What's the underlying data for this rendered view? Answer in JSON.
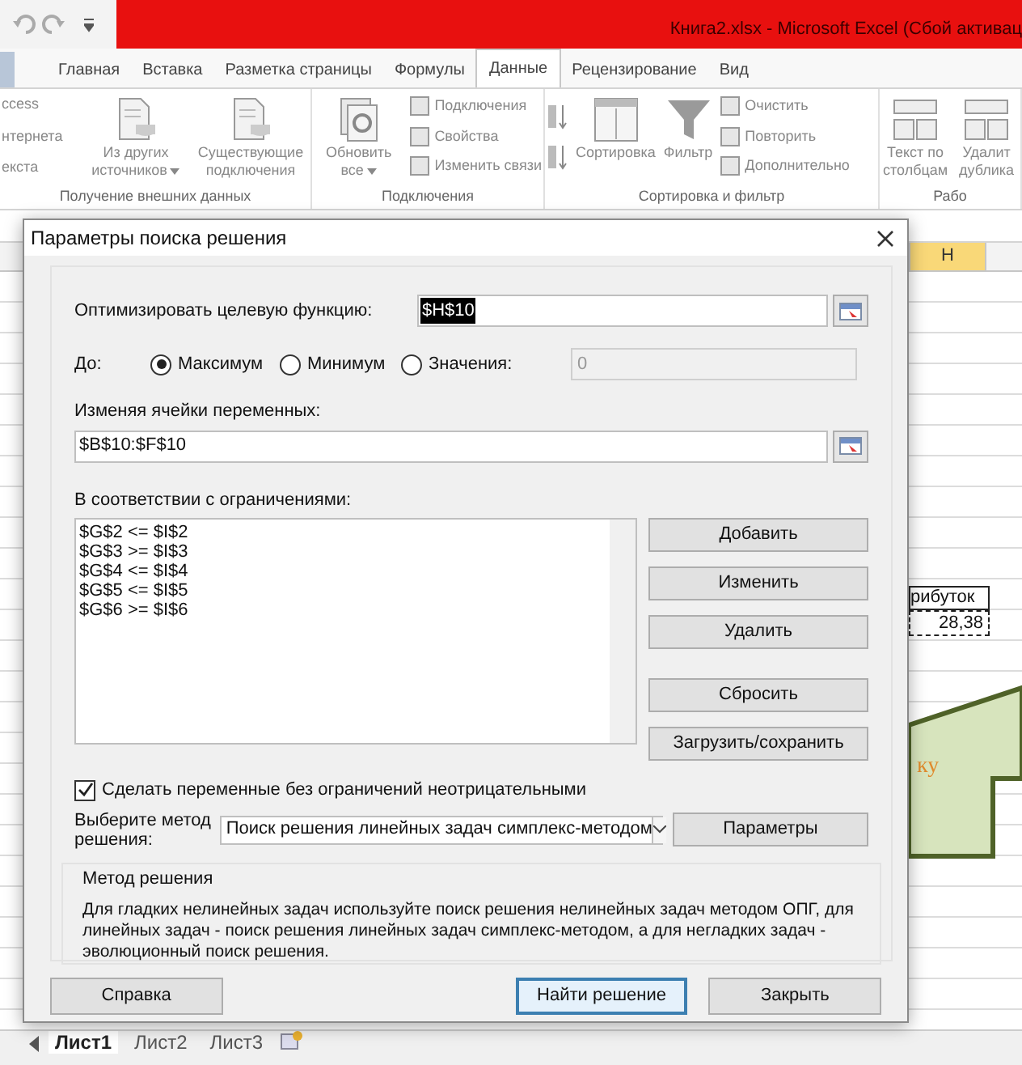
{
  "title_bar": {
    "title": "Книга2.xlsx  -  Microsoft Excel (Сбой активац"
  },
  "ribbon_tabs": [
    {
      "label": "Главная",
      "selected": false
    },
    {
      "label": "Вставка",
      "selected": false
    },
    {
      "label": "Разметка страницы",
      "selected": false
    },
    {
      "label": "Формулы",
      "selected": false
    },
    {
      "label": "Данные",
      "selected": true
    },
    {
      "label": "Рецензирование",
      "selected": false
    },
    {
      "label": "Вид",
      "selected": false
    }
  ],
  "ribbon_groups": [
    {
      "label": "Получение внешних данных",
      "items": [
        {
          "kind": "cut_stack",
          "lines": [
            "ccess",
            "нтернета",
            "екста"
          ]
        },
        {
          "kind": "large",
          "label": "Из других источников",
          "dropdown": true
        },
        {
          "kind": "large",
          "label": "Существующие подключения",
          "dropdown": false
        }
      ]
    },
    {
      "label": "Подключения",
      "items": [
        {
          "kind": "large",
          "label": "Обновить все",
          "dropdown": true
        },
        {
          "kind": "small_stack",
          "lines": [
            "Подключения",
            "Свойства",
            "Изменить связи"
          ]
        }
      ]
    },
    {
      "label": "Сортировка и фильтр",
      "items": [
        {
          "kind": "sort_stack"
        },
        {
          "kind": "large",
          "label": "Сортировка",
          "dropdown": false
        },
        {
          "kind": "large",
          "label": "Фильтр",
          "dropdown": false
        },
        {
          "kind": "small_stack",
          "lines": [
            "Очистить",
            "Повторить",
            "Дополнительно"
          ]
        }
      ]
    },
    {
      "label": "Рабо",
      "items": [
        {
          "kind": "large",
          "label": "Текст по столбцам",
          "dropdown": false
        },
        {
          "kind": "large",
          "label": "Удалит дублика",
          "dropdown": false
        }
      ]
    }
  ],
  "sheet": {
    "column_header": "H",
    "cell_label": "рибуток",
    "cell_value": "28,38",
    "shape_text": "ку",
    "sheet_tabs": [
      {
        "label": "Лист1",
        "selected": true
      },
      {
        "label": "Лист2",
        "selected": false
      },
      {
        "label": "Лист3",
        "selected": false
      }
    ]
  },
  "dialog": {
    "title": "Параметры поиска решения",
    "objective_label": "Оптимизировать целевую функцию:",
    "objective_value": "$H$10",
    "to_label": "До:",
    "to_options": [
      {
        "label": "Максимум",
        "selected": true
      },
      {
        "label": "Минимум",
        "selected": false
      },
      {
        "label": "Значения:",
        "selected": false
      }
    ],
    "value_field": {
      "value": "0",
      "disabled": true
    },
    "variables_label": "Изменяя ячейки переменных:",
    "variables_value": "$B$10:$F$10",
    "constraints_label": "В соответствии с ограничениями:",
    "constraints": [
      "$G$2 <= $I$2",
      "$G$3 >= $I$3",
      "$G$4 <= $I$4",
      "$G$5 <= $I$5",
      "$G$6 >= $I$6"
    ],
    "constraint_buttons": [
      "Добавить",
      "Изменить",
      "Удалить",
      "Сбросить",
      "Загрузить/сохранить"
    ],
    "nonnegative": {
      "label": "Сделать переменные без ограничений неотрицательными",
      "checked": true
    },
    "method_label": "Выберите метод решения:",
    "method_value": "Поиск решения линейных задач симплекс-методом",
    "parameters_button": "Параметры",
    "method_group": {
      "title": "Метод решения",
      "text": "Для гладких нелинейных задач используйте поиск решения нелинейных задач методом ОПГ, для линейных задач - поиск решения линейных задач симплекс-методом, а для негладких задач - эволюционный поиск решения."
    },
    "buttons": [
      {
        "label": "Справка",
        "default": false
      },
      {
        "label": "Найти решение",
        "default": true
      },
      {
        "label": "Закрыть",
        "default": false
      }
    ]
  }
}
